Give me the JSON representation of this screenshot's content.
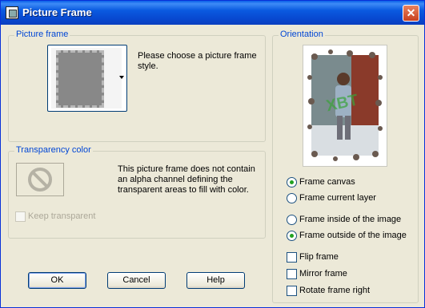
{
  "window": {
    "title": "Picture Frame",
    "close_glyph": "✕"
  },
  "picture_frame_group": {
    "label": "Picture frame",
    "instruction": "Please choose a picture frame style."
  },
  "transparency_group": {
    "label": "Transparency color",
    "description": "This picture frame does not contain an alpha channel defining the transparent areas to fill with color.",
    "keep_transparent_label": "Keep transparent",
    "keep_transparent_checked": false,
    "keep_transparent_enabled": false
  },
  "orientation_group": {
    "label": "Orientation",
    "preview_watermark": "XBT",
    "radio_canvas_layer": [
      {
        "label": "Frame canvas",
        "selected": true
      },
      {
        "label": "Frame current layer",
        "selected": false
      }
    ],
    "radio_inside_outside": [
      {
        "label": "Frame inside of the image",
        "selected": false
      },
      {
        "label": "Frame outside of the image",
        "selected": true
      }
    ],
    "checkboxes": [
      {
        "label": "Flip frame",
        "checked": false
      },
      {
        "label": "Mirror frame",
        "checked": false
      },
      {
        "label": "Rotate frame right",
        "checked": false
      }
    ]
  },
  "buttons": {
    "ok": "OK",
    "cancel": "Cancel",
    "help": "Help"
  },
  "colors": {
    "title_bar": "#0a5ae0",
    "group_label": "#0046d5",
    "dialog_bg": "#ece9d8",
    "radio_dot": "#21a121"
  }
}
